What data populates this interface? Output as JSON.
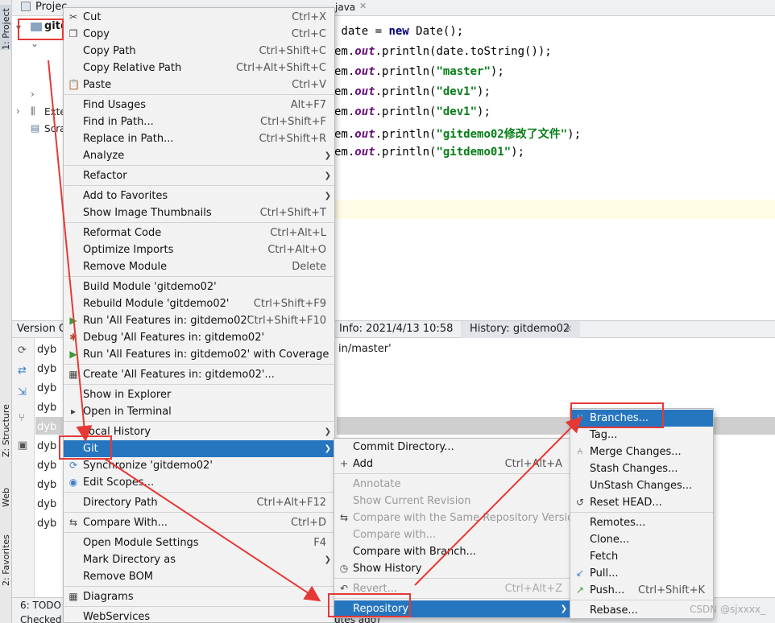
{
  "left_strip": {
    "project": "1: Project",
    "structure": "Z: Structure",
    "web": "Web",
    "favorites": "2: Favorites"
  },
  "project_panel": {
    "tab": "Projec",
    "root": "gitd",
    "items": [
      "Exte",
      "Scra"
    ]
  },
  "editor": {
    "tab": "java",
    "lines": [
      {
        "a": " date = ",
        "kw": "new",
        "b": " Date();"
      },
      {
        "a": "em.",
        "f": "out",
        "b": ".println(date.toString());"
      },
      {
        "a": "em.",
        "f": "out",
        "b": ".println(",
        "s": "\"master\"",
        "c": ");"
      },
      {
        "a": "em.",
        "f": "out",
        "b": ".println(",
        "s": "\"dev1\"",
        "c": ");"
      },
      {
        "a": "em.",
        "f": "out",
        "b": ".println(",
        "s": "\"dev1\"",
        "c": ");"
      },
      {
        "a": "em.",
        "f": "out",
        "b": ".println(",
        "s": "\"gitdemo02修改了文件\"",
        "c": ");"
      },
      {
        "a": "em.",
        "f": "out",
        "b": ".println(",
        "s": "\"gitdemo01\"",
        "c": ");"
      }
    ]
  },
  "version_control": {
    "title": "Version C",
    "info_tab": "Info: 2021/4/13 10:58",
    "history_tab": "History: gitdemo02",
    "detail": "in/master'",
    "author": "dyb",
    "footer": "utes ago)"
  },
  "bottom_bar": {
    "todo": "6: TODO",
    "checked": "Checked"
  },
  "context_menu": [
    {
      "label": "Cut",
      "shortcut": "Ctrl+X",
      "icon": "scissors-icon"
    },
    {
      "label": "Copy",
      "shortcut": "Ctrl+C",
      "icon": "copy-icon"
    },
    {
      "label": "Copy Path",
      "shortcut": "Ctrl+Shift+C"
    },
    {
      "label": "Copy Relative Path",
      "shortcut": "Ctrl+Alt+Shift+C"
    },
    {
      "label": "Paste",
      "shortcut": "Ctrl+V",
      "icon": "clipboard-icon"
    },
    {
      "sep": true
    },
    {
      "label": "Find Usages",
      "shortcut": "Alt+F7"
    },
    {
      "label": "Find in Path...",
      "shortcut": "Ctrl+Shift+F"
    },
    {
      "label": "Replace in Path...",
      "shortcut": "Ctrl+Shift+R"
    },
    {
      "label": "Analyze",
      "submenu": true
    },
    {
      "sep": true
    },
    {
      "label": "Refactor",
      "submenu": true
    },
    {
      "sep": true
    },
    {
      "label": "Add to Favorites",
      "submenu": true
    },
    {
      "label": "Show Image Thumbnails",
      "shortcut": "Ctrl+Shift+T"
    },
    {
      "sep": true
    },
    {
      "label": "Reformat Code",
      "shortcut": "Ctrl+Alt+L"
    },
    {
      "label": "Optimize Imports",
      "shortcut": "Ctrl+Alt+O"
    },
    {
      "label": "Remove Module",
      "shortcut": "Delete"
    },
    {
      "sep": true
    },
    {
      "label": "Build Module 'gitdemo02'"
    },
    {
      "label": "Rebuild Module 'gitdemo02'",
      "shortcut": "Ctrl+Shift+F9"
    },
    {
      "label": "Run 'All Features in: gitdemo02'",
      "shortcut": "Ctrl+Shift+F10",
      "icon": "run-icon"
    },
    {
      "label": "Debug 'All Features in: gitdemo02'",
      "icon": "debug-icon"
    },
    {
      "label": "Run 'All Features in: gitdemo02' with Coverage",
      "icon": "coverage-icon"
    },
    {
      "sep": true
    },
    {
      "label": "Create 'All Features in: gitdemo02'...",
      "icon": "create-config-icon"
    },
    {
      "sep": true
    },
    {
      "label": "Show in Explorer"
    },
    {
      "label": "Open in Terminal",
      "icon": "terminal-icon"
    },
    {
      "sep": true
    },
    {
      "label": "Local History",
      "submenu": true
    },
    {
      "label": "Git",
      "submenu": true,
      "selected": true
    },
    {
      "label": "Synchronize 'gitdemo02'",
      "icon": "sync-icon"
    },
    {
      "label": "Edit Scopes...",
      "icon": "scope-icon"
    },
    {
      "sep": true
    },
    {
      "label": "Directory Path",
      "shortcut": "Ctrl+Alt+F12"
    },
    {
      "sep": true
    },
    {
      "label": "Compare With...",
      "shortcut": "Ctrl+D",
      "icon": "compare-icon"
    },
    {
      "sep": true
    },
    {
      "label": "Open Module Settings",
      "shortcut": "F4"
    },
    {
      "label": "Mark Directory as",
      "submenu": true
    },
    {
      "label": "Remove BOM"
    },
    {
      "sep": true
    },
    {
      "label": "Diagrams",
      "icon": "diagram-icon"
    },
    {
      "sep": true
    },
    {
      "label": "WebServices"
    }
  ],
  "git_menu": [
    {
      "label": "Commit Directory..."
    },
    {
      "label": "Add",
      "shortcut": "Ctrl+Alt+A",
      "icon": "plus-icon"
    },
    {
      "sep": true
    },
    {
      "label": "Annotate",
      "disabled": true
    },
    {
      "label": "Show Current Revision",
      "disabled": true
    },
    {
      "label": "Compare with the Same Repository Version",
      "disabled": true,
      "icon": "compare-icon"
    },
    {
      "label": "Compare with...",
      "disabled": true
    },
    {
      "label": "Compare with Branch..."
    },
    {
      "label": "Show History",
      "icon": "clock-icon"
    },
    {
      "sep": true
    },
    {
      "label": "Revert...",
      "shortcut": "Ctrl+Alt+Z",
      "disabled": true,
      "icon": "revert-icon"
    },
    {
      "sep": true
    },
    {
      "label": "Repository",
      "submenu": true,
      "selected": true
    }
  ],
  "repository_menu": [
    {
      "label": "Branches...",
      "selected": true,
      "icon": "branch-icon"
    },
    {
      "label": "Tag..."
    },
    {
      "label": "Merge Changes...",
      "icon": "merge-icon"
    },
    {
      "label": "Stash Changes..."
    },
    {
      "label": "UnStash Changes..."
    },
    {
      "label": "Reset HEAD...",
      "icon": "reset-icon"
    },
    {
      "sep": true
    },
    {
      "label": "Remotes..."
    },
    {
      "label": "Clone..."
    },
    {
      "label": "Fetch"
    },
    {
      "label": "Pull...",
      "icon": "pull-icon"
    },
    {
      "label": "Push...",
      "shortcut": "Ctrl+Shift+K",
      "icon": "push-icon"
    },
    {
      "sep": true
    },
    {
      "label": "Rebase..."
    }
  ],
  "watermark": "CSDN @sjxxxx_"
}
